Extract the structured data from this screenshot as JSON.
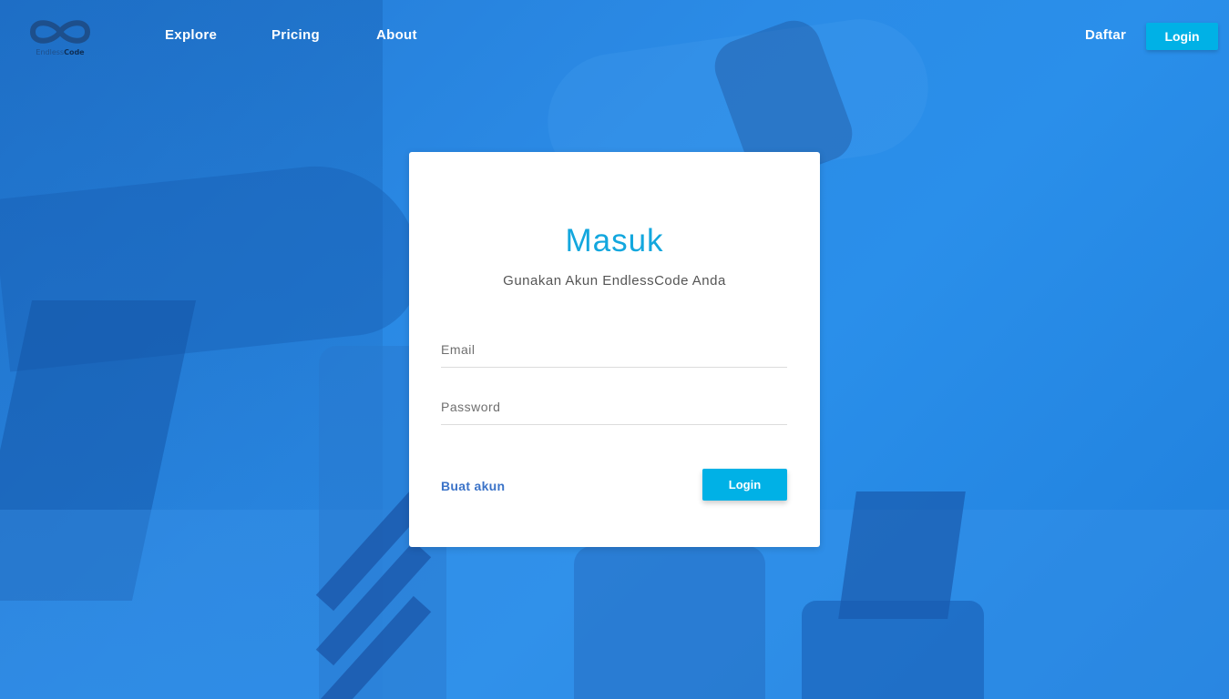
{
  "brand": {
    "logo_text_light": "Endless",
    "logo_text_bold": "Code"
  },
  "nav": {
    "items": [
      {
        "label": "Explore"
      },
      {
        "label": "Pricing"
      },
      {
        "label": "About"
      }
    ],
    "register_label": "Daftar",
    "login_label": "Login"
  },
  "login_card": {
    "title": "Masuk",
    "subtitle": "Gunakan Akun EndlessCode Anda",
    "email": {
      "placeholder": "Email",
      "value": ""
    },
    "password": {
      "placeholder": "Password",
      "value": ""
    },
    "create_account_label": "Buat akun",
    "submit_label": "Login"
  },
  "colors": {
    "accent": "#00b1e6",
    "title": "#13a7de",
    "link": "#3b73c8",
    "background": "#2b8be6"
  }
}
